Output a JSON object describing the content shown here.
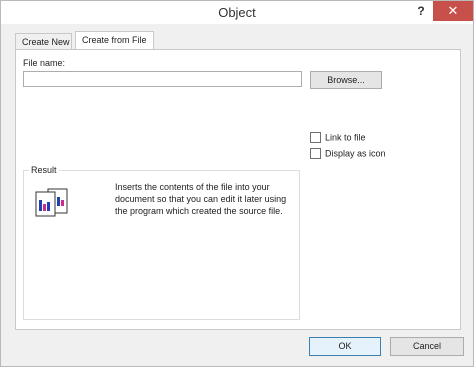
{
  "window": {
    "title": "Object",
    "help_glyph": "?",
    "close_glyph": "✕"
  },
  "tabs": [
    {
      "label": "Create New",
      "active": false
    },
    {
      "label": "Create from File",
      "active": true
    }
  ],
  "file_section": {
    "file_name_label": "File name:",
    "file_name_value": "",
    "browse_label": "Browse..."
  },
  "options": {
    "link_to_file": {
      "label": "Link to file",
      "checked": false
    },
    "display_as_icon": {
      "label": "Display as icon",
      "checked": false
    }
  },
  "result": {
    "legend": "Result",
    "description": "Inserts the contents of the file into your document so that you can edit it later using the program which created the source file."
  },
  "footer": {
    "ok_label": "OK",
    "cancel_label": "Cancel"
  },
  "colors": {
    "close_button": "#c7504a",
    "primary_button_border": "#3c7fb1"
  }
}
